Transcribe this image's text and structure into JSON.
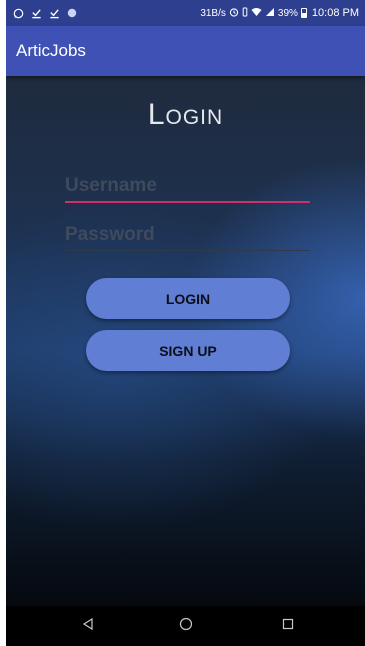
{
  "status_bar": {
    "icons_left": [
      "whatsapp-icon",
      "download-done-icon",
      "download-done-icon",
      "circle-notification-icon"
    ],
    "data_speed": "31B/s",
    "battery": "39%",
    "time": "10:08 PM"
  },
  "app_bar": {
    "title": "ArticJobs"
  },
  "login": {
    "title": "Login",
    "username_placeholder": "Username",
    "password_placeholder": "Password",
    "login_button": "LOGIN",
    "signup_button": "SIGN UP"
  },
  "nav_bar": {
    "icons": [
      "back-icon",
      "home-icon",
      "recents-icon"
    ]
  },
  "colors": {
    "app_bar": "#3f51b5",
    "status_bar": "#2e3f8f",
    "button": "#5f7ed4",
    "username_underline": "#d0306a"
  }
}
